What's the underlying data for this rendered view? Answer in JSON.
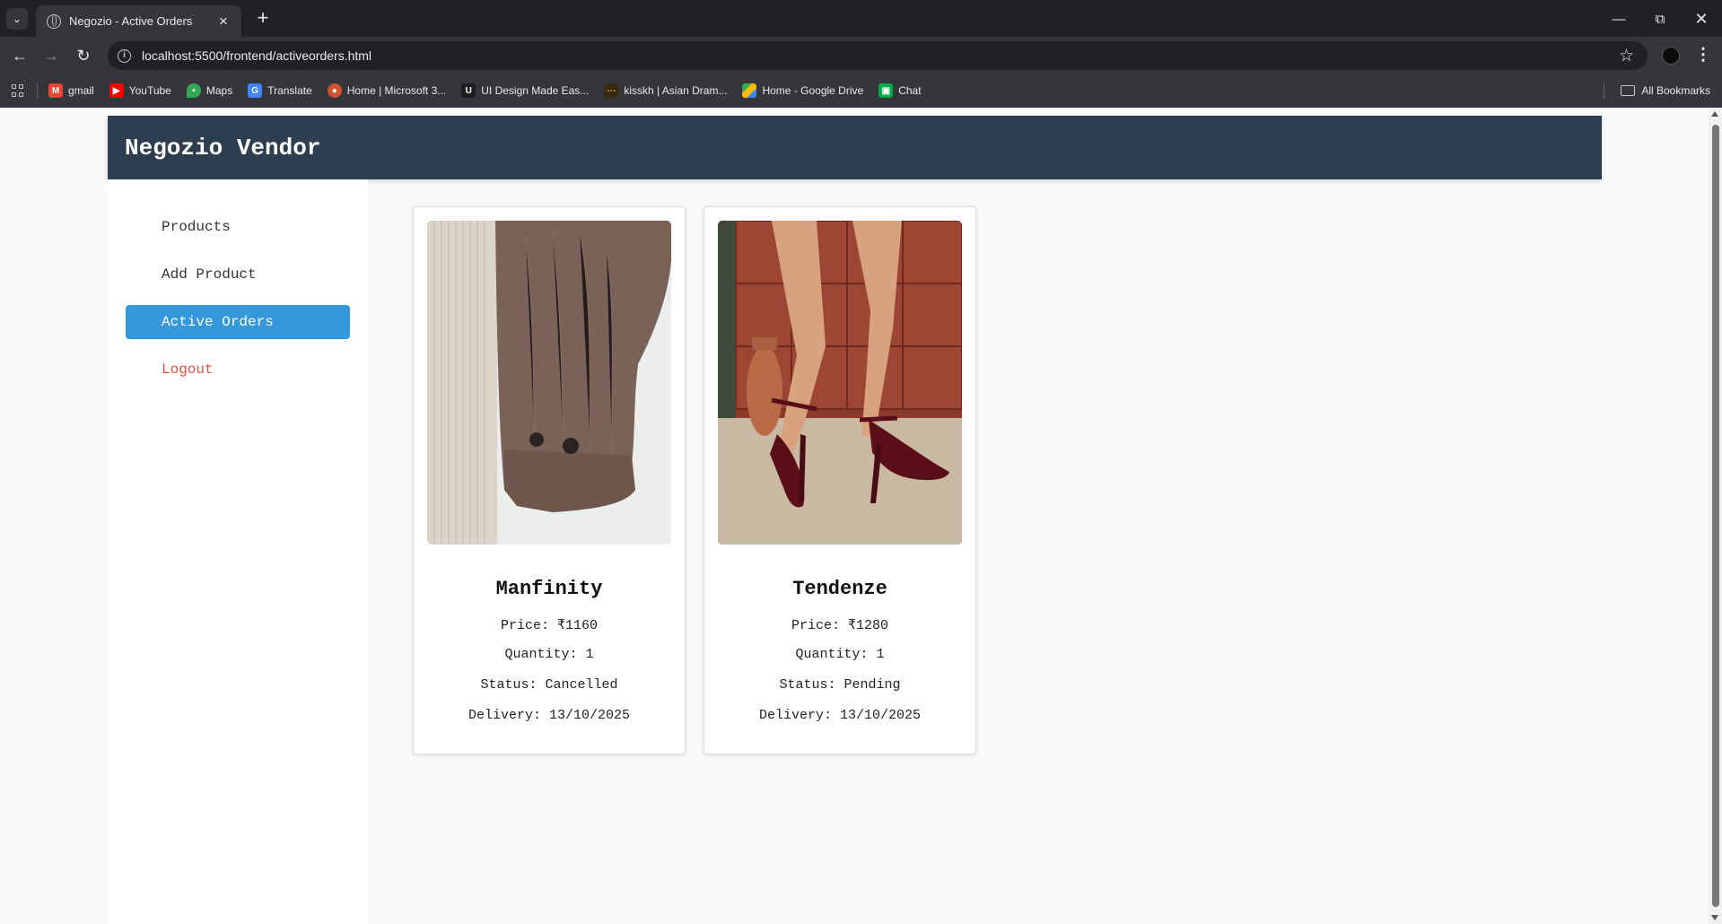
{
  "browser": {
    "tab_title": "Negozio - Active Orders",
    "url": "localhost:5500/frontend/activeorders.html",
    "bookmarks": [
      {
        "label": "gmail",
        "icon": "gmail-icon",
        "color": "#ea4335"
      },
      {
        "label": "YouTube",
        "icon": "youtube-icon",
        "color": "#ff0000"
      },
      {
        "label": "Maps",
        "icon": "maps-icon",
        "color": "#34a853"
      },
      {
        "label": "Translate",
        "icon": "translate-icon",
        "color": "#4285f4"
      },
      {
        "label": "Home | Microsoft 3...",
        "icon": "microsoft365-icon",
        "color": "#d35230"
      },
      {
        "label": "UI Design Made Eas...",
        "icon": "udemy-icon",
        "color": "#1c1d1f"
      },
      {
        "label": "kisskh | Asian Dram...",
        "icon": "kisskh-icon",
        "color": "#f5a623"
      },
      {
        "label": "Home - Google Drive",
        "icon": "google-drive-icon",
        "color": "#fbbc04"
      },
      {
        "label": "Chat",
        "icon": "google-chat-icon",
        "color": "#00ac47"
      }
    ],
    "all_bookmarks": "All Bookmarks"
  },
  "app": {
    "brand": "Negozio Vendor",
    "accent_color": "#3498db",
    "header_color": "#2c3e50",
    "logout_color": "#e74c3c"
  },
  "sidebar": {
    "items": [
      {
        "label": "Products"
      },
      {
        "label": "Add Product"
      },
      {
        "label": "Active Orders"
      },
      {
        "label": "Logout"
      }
    ]
  },
  "orders": [
    {
      "name": "Manfinity",
      "price": "Price: ₹1160",
      "quantity": "Quantity: 1",
      "status": "Status: Cancelled",
      "delivery": "Delivery: 13/10/2025",
      "image": "brown-corduroy-shirt-sleeve-photo"
    },
    {
      "name": "Tendenze",
      "price": "Price: ₹1280",
      "quantity": "Quantity: 1",
      "status": "Status: Pending",
      "delivery": "Delivery: 13/10/2025",
      "image": "burgundy-heeled-sandals-photo"
    }
  ]
}
